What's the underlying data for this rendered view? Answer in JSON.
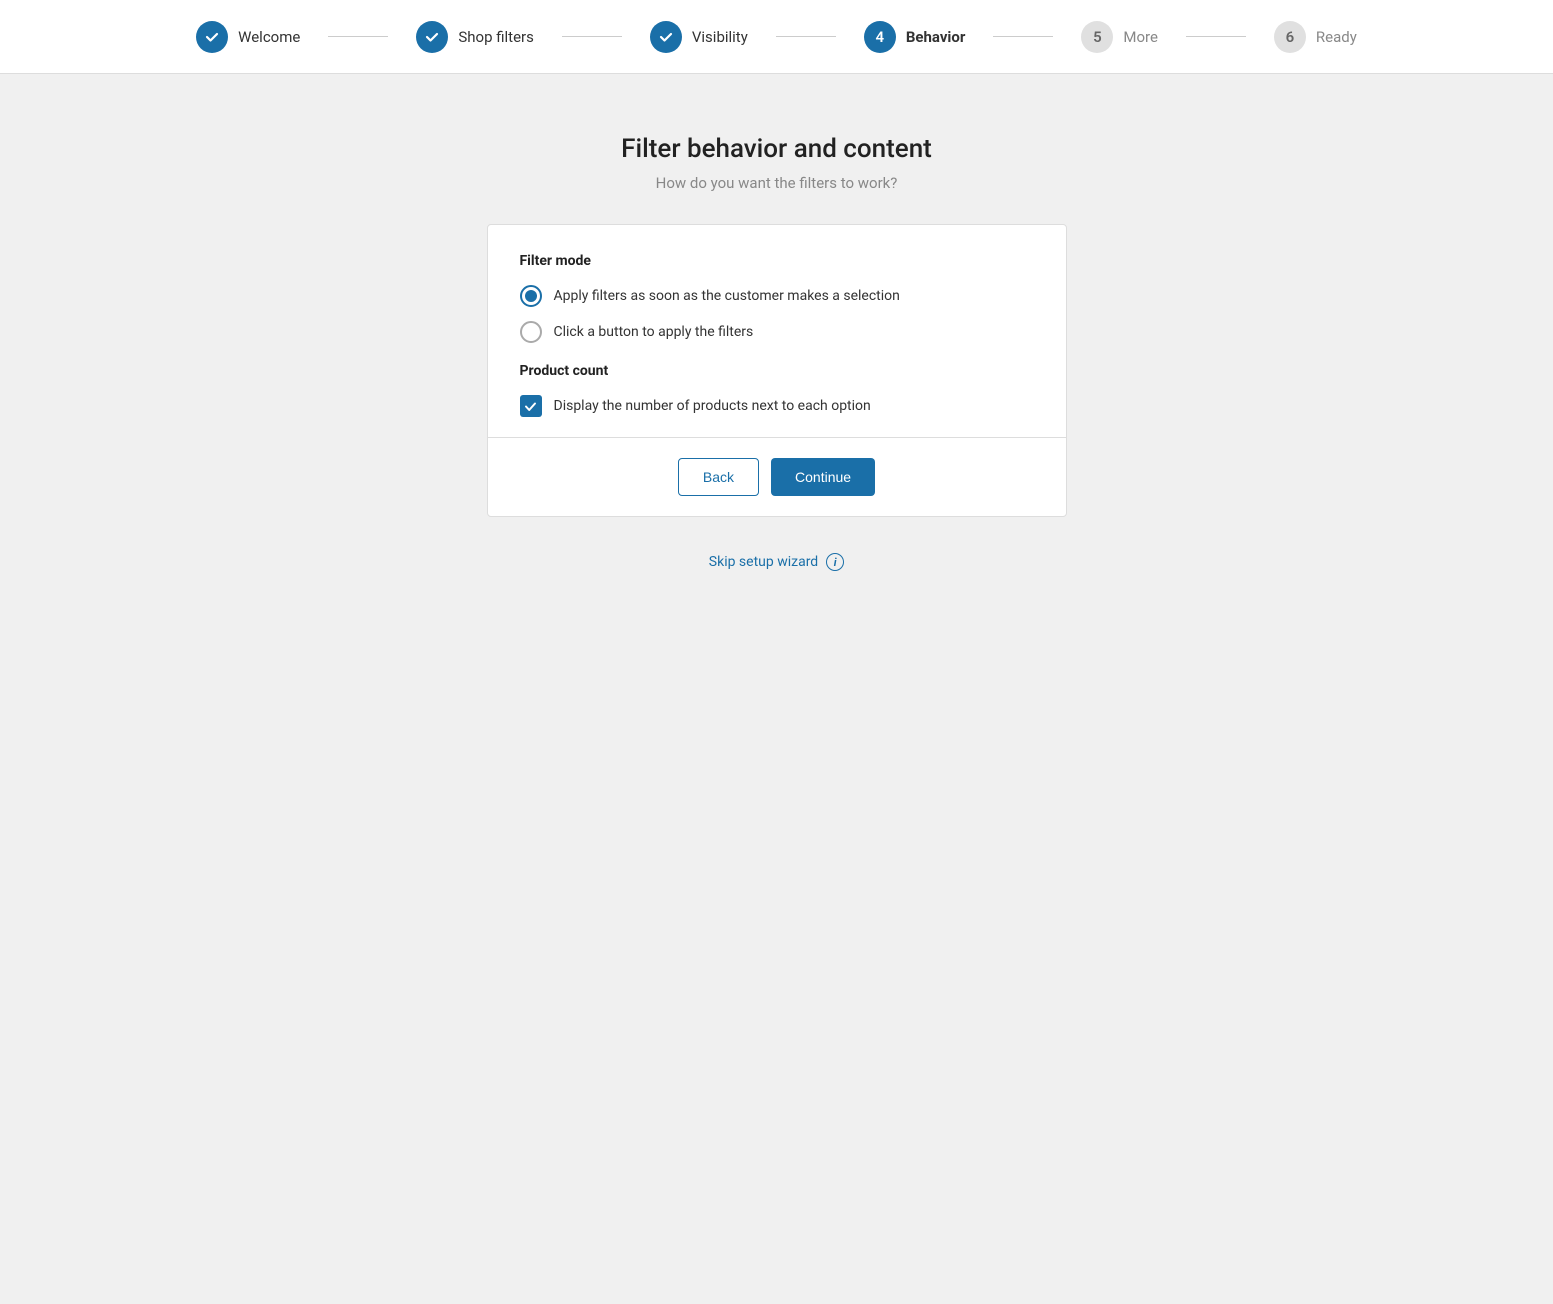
{
  "stepper": {
    "steps": [
      {
        "id": "welcome",
        "label": "Welcome",
        "state": "completed",
        "number": "1"
      },
      {
        "id": "shop-filters",
        "label": "Shop filters",
        "state": "completed",
        "number": "2"
      },
      {
        "id": "visibility",
        "label": "Visibility",
        "state": "completed",
        "number": "3"
      },
      {
        "id": "behavior",
        "label": "Behavior",
        "state": "active",
        "number": "4"
      },
      {
        "id": "more",
        "label": "More",
        "state": "inactive",
        "number": "5"
      },
      {
        "id": "ready",
        "label": "Ready",
        "state": "inactive",
        "number": "6"
      }
    ]
  },
  "page": {
    "title": "Filter behavior and content",
    "subtitle": "How do you want the filters to work?"
  },
  "form": {
    "filter_mode_label": "Filter mode",
    "radio_option_1": "Apply filters as soon as the customer makes a selection",
    "radio_option_2": "Click a button to apply the filters",
    "product_count_label": "Product count",
    "checkbox_option": "Display the number of products next to each option"
  },
  "footer": {
    "back_label": "Back",
    "continue_label": "Continue"
  },
  "skip": {
    "label": "Skip setup wizard",
    "info_symbol": "i"
  },
  "colors": {
    "brand": "#1a6fa8",
    "completed_bg": "#1a6fa8",
    "inactive_bg": "#e0e0e0"
  }
}
